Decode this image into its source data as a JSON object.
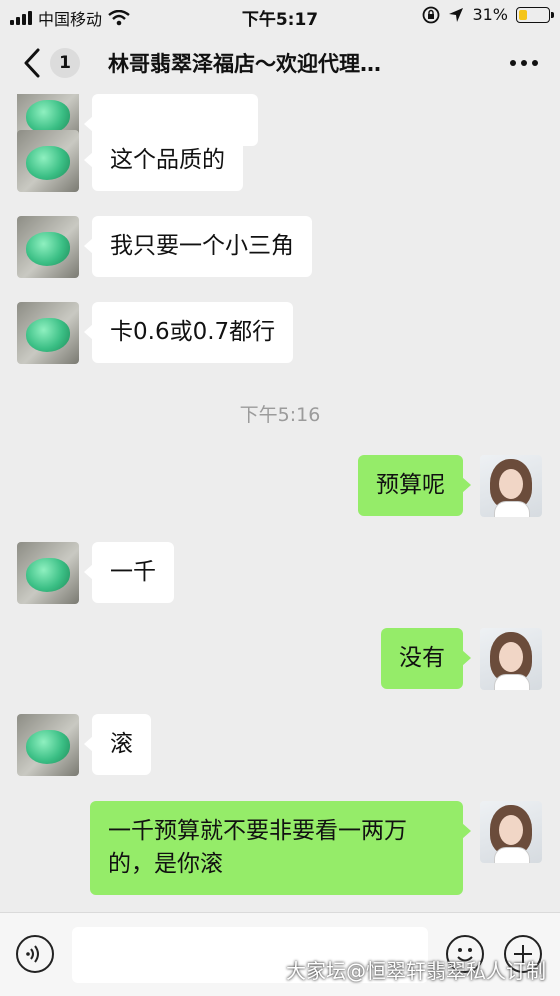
{
  "status_bar": {
    "carrier": "中国移动",
    "time": "下午5:17",
    "battery_percent": "31%",
    "battery_level": 0.31
  },
  "header": {
    "unread_count": "1",
    "title": "林哥翡翠泽福店～欢迎代理…"
  },
  "messages": [
    {
      "sender": "other",
      "text": "这个品质的"
    },
    {
      "sender": "other",
      "text": "我只要一个小三角"
    },
    {
      "sender": "other",
      "text": "卡0.6或0.7都行"
    },
    {
      "type": "timestamp",
      "text": "下午5:16"
    },
    {
      "sender": "me",
      "text": "预算呢"
    },
    {
      "sender": "other",
      "text": "一千"
    },
    {
      "sender": "me",
      "text": "没有"
    },
    {
      "sender": "other",
      "text": "滚"
    },
    {
      "sender": "me",
      "text": "一千预算就不要非要看一两万\n的，是你滚"
    }
  ],
  "input_bar": {
    "text": ""
  },
  "watermark": "大家坛@恒翠轩翡翠私人订制",
  "colors": {
    "my_bubble": "#95ec69",
    "other_bubble": "#ffffff",
    "background": "#ededed"
  },
  "icons": [
    "back-chevron-icon",
    "more-dots-icon",
    "voice-icon",
    "emoji-icon",
    "plus-icon",
    "wifi-icon",
    "location-icon",
    "lock-rotation-icon"
  ]
}
